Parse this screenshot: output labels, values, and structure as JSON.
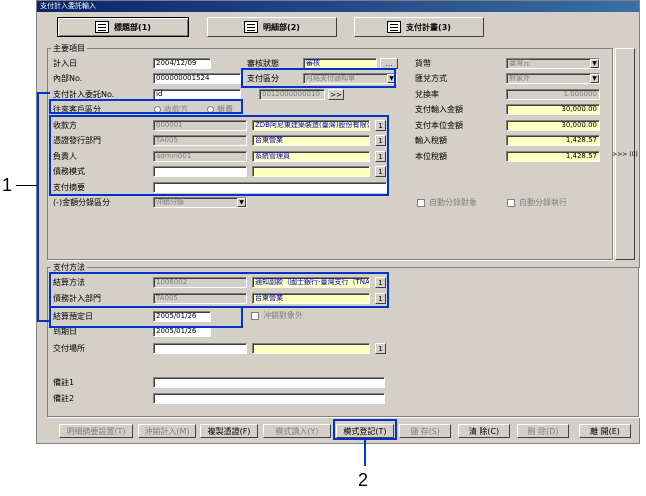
{
  "window": {
    "title": "支付計入委託輸入"
  },
  "tabs": [
    {
      "label": "標題部(1)",
      "active": true
    },
    {
      "label": "明細部(2)",
      "active": false
    },
    {
      "label": "支付計畫(3)",
      "active": false
    }
  ],
  "main": {
    "group_title": "主要項目",
    "record_date_label": "計入日",
    "record_date": "2004/12/09",
    "internal_no_label": "內部No.",
    "internal_no": "000000001524",
    "request_no_label": "支付計入委託No.",
    "request_no": "id",
    "review_status_label": "審核狀態",
    "review_status": "審核",
    "payment_type_label": "支付區分",
    "payment_type": "月結支付通知單",
    "doc_no": "0012000000010",
    "partner_type_label": "往來客戶區分",
    "partner_type_opt1": "收款方",
    "partner_type_opt2": "雜費",
    "payee_label": "收款方",
    "payee_code": "000001",
    "payee_name": "ZDB阿尼東建築裝造(臺灣)股份有限公司",
    "issuing_dept_label": "憑證發行部門",
    "issuing_dept_code": "TA005",
    "issuing_dept_name": "台東營業",
    "owner_label": "負責人",
    "owner_code": "admin001",
    "owner_name": "系統管理員",
    "debt_model_label": "債務模式",
    "payment_summary_label": "支付摘要",
    "amount_split_label": "(-)金額分錄區分",
    "amount_split": "沖銷分錄",
    "currency_label": "貨幣",
    "currency": "臺灣元",
    "exch_method_label": "匯兌方式",
    "exch_method": "對象外",
    "exch_rate_label": "兌換率",
    "exch_rate": "1.000000",
    "pay_amount_label": "支付輸入金額",
    "pay_amount": "30,000.00",
    "local_amount_label": "支付本位金額",
    "local_amount": "30,000.00",
    "input_tax_label": "輸入稅額",
    "input_tax": "1,428.57",
    "local_tax_label": "本位稅額",
    "local_tax": "1,428.57",
    "auto_split_target_label": "自動分錄對象",
    "auto_split_exec_label": "自動分錄執行",
    "side_button": ">>> (0)"
  },
  "payment": {
    "group_title": "支付方法",
    "settle_method_label": "結算方法",
    "settle_code": "1006002",
    "settle_name": "通知副款（國士銀行-臺灣支行（TNAS））",
    "debt_dept_label": "債務計入部門",
    "debt_dept_code": "TA005",
    "debt_dept_name": "台東營業",
    "settle_date_label": "結算預定日",
    "settle_date": "2005/01/26",
    "due_date_label": "到期日",
    "due_date": "2005/01/26",
    "offset_label": "沖銷對象外",
    "delivery_place_label": "交付場所"
  },
  "notes": {
    "note1_label": "備註1",
    "note2_label": "備註2"
  },
  "bottom_buttons": [
    {
      "label": "明細摘要設置(T)",
      "enabled": false
    },
    {
      "label": "沖銷計入(M)",
      "enabled": false
    },
    {
      "label": "複製憑證(F)",
      "enabled": true
    },
    {
      "label": "模式讀入(Y)",
      "enabled": false
    },
    {
      "label": "模式登記(T)",
      "enabled": true
    },
    {
      "label": "儲 存(S)",
      "enabled": false
    },
    {
      "label": "清 除(C)",
      "enabled": true
    },
    {
      "label": "刪 除(D)",
      "enabled": false
    },
    {
      "label": "離 開(E)",
      "enabled": true
    }
  ],
  "callouts": {
    "one": "1",
    "two": "2"
  },
  "glyphs": {
    "ellipsis": "…",
    "dropdown": "▼",
    "lookup": "1",
    "nav": ">>"
  },
  "colors": {
    "highlight": "#0033cc",
    "readonly_yellow": "#ffffc0",
    "title_bar": "#0a246a"
  }
}
